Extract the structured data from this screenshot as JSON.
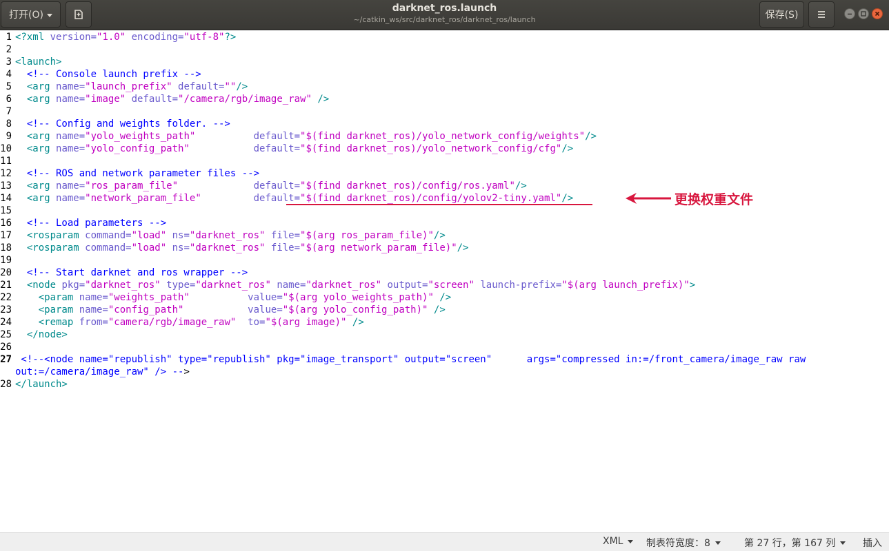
{
  "header": {
    "open_label": "打开(O)",
    "title": "darknet_ros.launch",
    "subtitle": "~/catkin_ws/src/darknet_ros/darknet_ros/launch",
    "save_label": "保存(S)"
  },
  "editor": {
    "lines": [
      {
        "n": "1",
        "tokens": [
          [
            "tag",
            "<?xml "
          ],
          [
            "attr",
            "version="
          ],
          [
            "str",
            "\"1.0\""
          ],
          [
            "attr",
            " encoding="
          ],
          [
            "str",
            "\"utf-8\""
          ],
          [
            "tag",
            "?>"
          ]
        ]
      },
      {
        "n": "2",
        "tokens": []
      },
      {
        "n": "3",
        "tokens": [
          [
            "tag",
            "<launch>"
          ]
        ]
      },
      {
        "n": "4",
        "tokens": [
          [
            "com",
            "  <!-- Console launch prefix -->"
          ]
        ]
      },
      {
        "n": "5",
        "tokens": [
          [
            "tag",
            "  <arg "
          ],
          [
            "attr",
            "name="
          ],
          [
            "str",
            "\"launch_prefix\""
          ],
          [
            "attr",
            " default="
          ],
          [
            "str",
            "\"\""
          ],
          [
            "tag",
            "/>"
          ]
        ]
      },
      {
        "n": "6",
        "tokens": [
          [
            "tag",
            "  <arg "
          ],
          [
            "attr",
            "name="
          ],
          [
            "str",
            "\"image\""
          ],
          [
            "attr",
            " default="
          ],
          [
            "str",
            "\"/camera/rgb/image_raw\""
          ],
          [
            "tag",
            " />"
          ]
        ]
      },
      {
        "n": "7",
        "tokens": []
      },
      {
        "n": "8",
        "tokens": [
          [
            "com",
            "  <!-- Config and weights folder. -->"
          ]
        ]
      },
      {
        "n": "9",
        "tokens": [
          [
            "tag",
            "  <arg "
          ],
          [
            "attr",
            "name="
          ],
          [
            "str",
            "\"yolo_weights_path\""
          ],
          [
            "attr",
            "          default="
          ],
          [
            "str",
            "\"$(find darknet_ros)/yolo_network_config/weights\""
          ],
          [
            "tag",
            "/>"
          ]
        ]
      },
      {
        "n": "10",
        "tokens": [
          [
            "tag",
            "  <arg "
          ],
          [
            "attr",
            "name="
          ],
          [
            "str",
            "\"yolo_config_path\""
          ],
          [
            "attr",
            "           default="
          ],
          [
            "str",
            "\"$(find darknet_ros)/yolo_network_config/cfg\""
          ],
          [
            "tag",
            "/>"
          ]
        ]
      },
      {
        "n": "11",
        "tokens": []
      },
      {
        "n": "12",
        "tokens": [
          [
            "com",
            "  <!-- ROS and network parameter files -->"
          ]
        ]
      },
      {
        "n": "13",
        "tokens": [
          [
            "tag",
            "  <arg "
          ],
          [
            "attr",
            "name="
          ],
          [
            "str",
            "\"ros_param_file\""
          ],
          [
            "attr",
            "             default="
          ],
          [
            "str",
            "\"$(find darknet_ros)/config/ros.yaml\""
          ],
          [
            "tag",
            "/>"
          ]
        ]
      },
      {
        "n": "14",
        "tokens": [
          [
            "tag",
            "  <arg "
          ],
          [
            "attr",
            "name="
          ],
          [
            "str",
            "\"network_param_file\""
          ],
          [
            "attr",
            "         default="
          ],
          [
            "str",
            "\"$(find darknet_ros)/config/yolov2-tiny.yaml\""
          ],
          [
            "tag",
            "/>"
          ]
        ]
      },
      {
        "n": "15",
        "tokens": []
      },
      {
        "n": "16",
        "tokens": [
          [
            "com",
            "  <!-- Load parameters -->"
          ]
        ]
      },
      {
        "n": "17",
        "tokens": [
          [
            "tag",
            "  <rosparam "
          ],
          [
            "attr",
            "command="
          ],
          [
            "str",
            "\"load\""
          ],
          [
            "attr",
            " ns="
          ],
          [
            "str",
            "\"darknet_ros\""
          ],
          [
            "attr",
            " file="
          ],
          [
            "str",
            "\"$(arg ros_param_file)\""
          ],
          [
            "tag",
            "/>"
          ]
        ]
      },
      {
        "n": "18",
        "tokens": [
          [
            "tag",
            "  <rosparam "
          ],
          [
            "attr",
            "command="
          ],
          [
            "str",
            "\"load\""
          ],
          [
            "attr",
            " ns="
          ],
          [
            "str",
            "\"darknet_ros\""
          ],
          [
            "attr",
            " file="
          ],
          [
            "str",
            "\"$(arg network_param_file)\""
          ],
          [
            "tag",
            "/>"
          ]
        ]
      },
      {
        "n": "19",
        "tokens": []
      },
      {
        "n": "20",
        "tokens": [
          [
            "com",
            "  <!-- Start darknet and ros wrapper -->"
          ]
        ]
      },
      {
        "n": "21",
        "tokens": [
          [
            "tag",
            "  <node "
          ],
          [
            "attr",
            "pkg="
          ],
          [
            "str",
            "\"darknet_ros\""
          ],
          [
            "attr",
            " type="
          ],
          [
            "str",
            "\"darknet_ros\""
          ],
          [
            "attr",
            " name="
          ],
          [
            "str",
            "\"darknet_ros\""
          ],
          [
            "attr",
            " output="
          ],
          [
            "str",
            "\"screen\""
          ],
          [
            "attr",
            " launch-prefix="
          ],
          [
            "str",
            "\"$(arg launch_prefix)\""
          ],
          [
            "tag",
            ">"
          ]
        ]
      },
      {
        "n": "22",
        "tokens": [
          [
            "tag",
            "    <param "
          ],
          [
            "attr",
            "name="
          ],
          [
            "str",
            "\"weights_path\""
          ],
          [
            "attr",
            "          value="
          ],
          [
            "str",
            "\"$(arg yolo_weights_path)\""
          ],
          [
            "tag",
            " />"
          ]
        ]
      },
      {
        "n": "23",
        "tokens": [
          [
            "tag",
            "    <param "
          ],
          [
            "attr",
            "name="
          ],
          [
            "str",
            "\"config_path\""
          ],
          [
            "attr",
            "           value="
          ],
          [
            "str",
            "\"$(arg yolo_config_path)\""
          ],
          [
            "tag",
            " />"
          ]
        ]
      },
      {
        "n": "24",
        "tokens": [
          [
            "tag",
            "    <remap "
          ],
          [
            "attr",
            "from="
          ],
          [
            "str",
            "\"camera/rgb/image_raw\""
          ],
          [
            "attr",
            "  to="
          ],
          [
            "str",
            "\"$(arg image)\""
          ],
          [
            "tag",
            " />"
          ]
        ]
      },
      {
        "n": "25",
        "tokens": [
          [
            "tag",
            "  </node>"
          ]
        ]
      },
      {
        "n": "26",
        "tokens": []
      },
      {
        "n": "27",
        "tokens": [
          [
            "com",
            " <!--<node name=\"republish\" type=\"republish\" pkg=\"image_transport\" output=\"screen\"      args=\"compressed in:=/front_camera/image_raw raw"
          ]
        ]
      },
      {
        "n": "",
        "tokens": [
          [
            "com",
            "out:=/camera/image_raw\" /> --"
          ],
          [
            "cur",
            ">"
          ]
        ]
      },
      {
        "n": "28",
        "tokens": [
          [
            "tag",
            "</launch>"
          ]
        ]
      }
    ]
  },
  "annotation": {
    "note": "更换权重文件",
    "color": "#d8163e"
  },
  "statusbar": {
    "language": "XML",
    "tab_width": "制表符宽度：8",
    "position": "第 27 行，第 167 列",
    "mode": "插入"
  }
}
